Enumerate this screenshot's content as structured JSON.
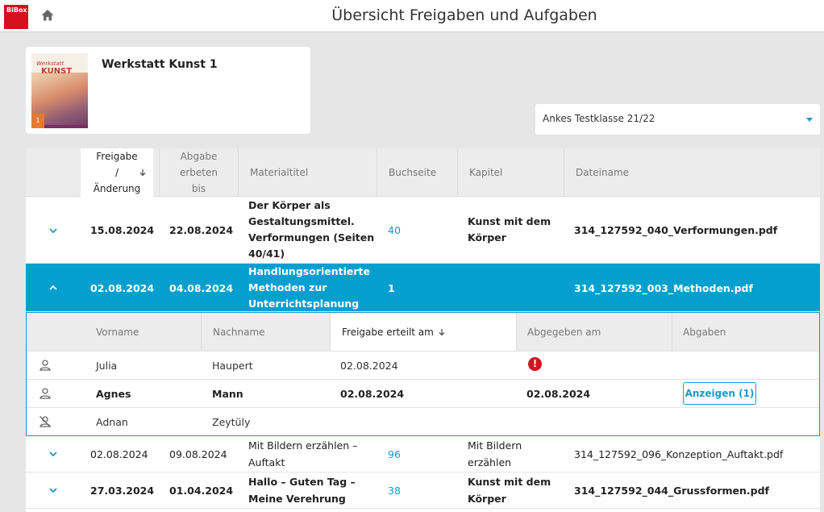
{
  "app": {
    "logo_text": "BiBox",
    "page_title": "Übersicht Freigaben und Aufgaben"
  },
  "book": {
    "title": "Werkstatt Kunst 1",
    "cover_line1": "Werkstatt",
    "cover_line2": "KUNST",
    "cover_number": "1"
  },
  "class_select": {
    "value": "Ankes Testklasse 21/22"
  },
  "table": {
    "headers": {
      "freigabe_line1": "Freigabe",
      "freigabe_line2": "/",
      "freigabe_line3": "Änderung",
      "abgabe_line1": "Abgabe",
      "abgabe_line2": "erbeten",
      "abgabe_line3": "bis",
      "materialtitel": "Materialtitel",
      "buchseite": "Buchseite",
      "kapitel": "Kapitel",
      "dateiname": "Dateiname"
    },
    "rows": [
      {
        "freigabe": "15.08.2024",
        "abgabe": "22.08.2024",
        "title_l1": "Der Körper als",
        "title_l2": "Gestaltungsmittel.",
        "title_l3": "Verformungen (Seiten",
        "title_l4": "40/41)",
        "seite": "40",
        "kapitel_l1": "Kunst mit dem",
        "kapitel_l2": "Körper",
        "datei": "314_127592_040_Verformungen.pdf"
      },
      {
        "freigabe": "02.08.2024",
        "abgabe": "04.08.2024",
        "title_l1": "Handlungsorientierte",
        "title_l2": "Methoden zur",
        "title_l3": "Unterrichtsplanung",
        "seite": "1",
        "kapitel_l1": "",
        "datei": "314_127592_003_Methoden.pdf"
      },
      {
        "freigabe": "02.08.2024",
        "abgabe": "09.08.2024",
        "title_l1": "Mit Bildern erzählen –",
        "title_l2": "Auftakt",
        "seite": "96",
        "kapitel_l1": "Mit Bildern",
        "kapitel_l2": "erzählen",
        "datei": "314_127592_096_Konzeption_Auftakt.pdf"
      },
      {
        "freigabe": "27.03.2024",
        "abgabe": "01.04.2024",
        "title_l1": "Hallo – Guten Tag –",
        "title_l2": "Meine Verehrung",
        "seite": "38",
        "kapitel_l1": "Kunst mit dem",
        "kapitel_l2": "Körper",
        "datei": "314_127592_044_Grussformen.pdf"
      }
    ]
  },
  "students": {
    "headers": {
      "vorname": "Vorname",
      "nachname": "Nachname",
      "freigabe": "Freigabe erteilt am",
      "abgegeben": "Abgegeben am",
      "abgaben": "Abgaben"
    },
    "rows": [
      {
        "vorname": "Julia",
        "nachname": "Haupert",
        "freigabe": "02.08.2024",
        "abgegeben": "",
        "abgaben": ""
      },
      {
        "vorname": "Agnes",
        "nachname": "Mann",
        "freigabe": "02.08.2024",
        "abgegeben": "02.08.2024",
        "abgaben": "Anzeigen (1)"
      },
      {
        "vorname": "Adnan",
        "nachname": "Zeytüly",
        "freigabe": "",
        "abgegeben": "",
        "abgaben": ""
      }
    ]
  },
  "colors": {
    "accent": "#039fcf",
    "brand": "#d6101f",
    "link": "#1a98c9"
  }
}
